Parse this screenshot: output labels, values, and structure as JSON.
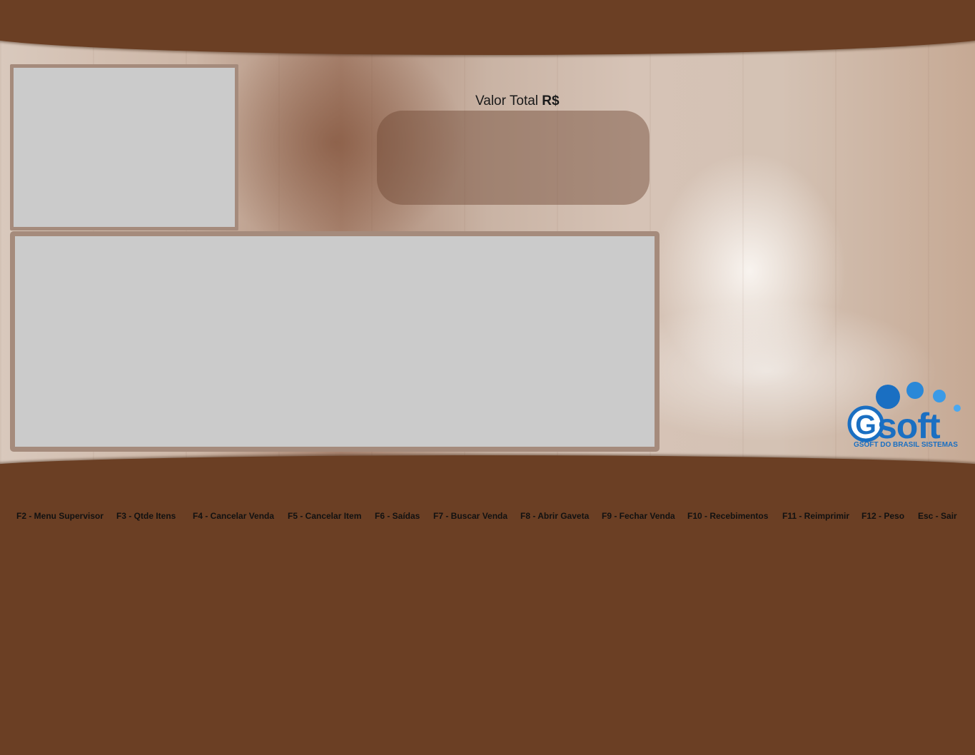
{
  "total": {
    "label": "Valor Total",
    "currency": "R$",
    "value": ""
  },
  "logo": {
    "name": "soft",
    "letter": "G",
    "subtitle": "GSOFT DO BRASIL SISTEMAS",
    "color": "#1a6fc2"
  },
  "colors": {
    "band": "#6b3f24",
    "panel": "#cbcbcb",
    "panel_border": "#a58b7c"
  },
  "function_keys": [
    "F2 - Menu Supervisor",
    "F3 - Qtde Itens",
    "F4 - Cancelar Venda",
    "F5 - Cancelar Item",
    "F6 - Saídas",
    "F7 - Buscar Venda",
    "F8 - Abrir Gaveta",
    "F9 - Fechar Venda",
    "F10 - Recebimentos",
    "F11 - Reimprimir",
    "F12 - Peso",
    "Esc - Sair"
  ]
}
